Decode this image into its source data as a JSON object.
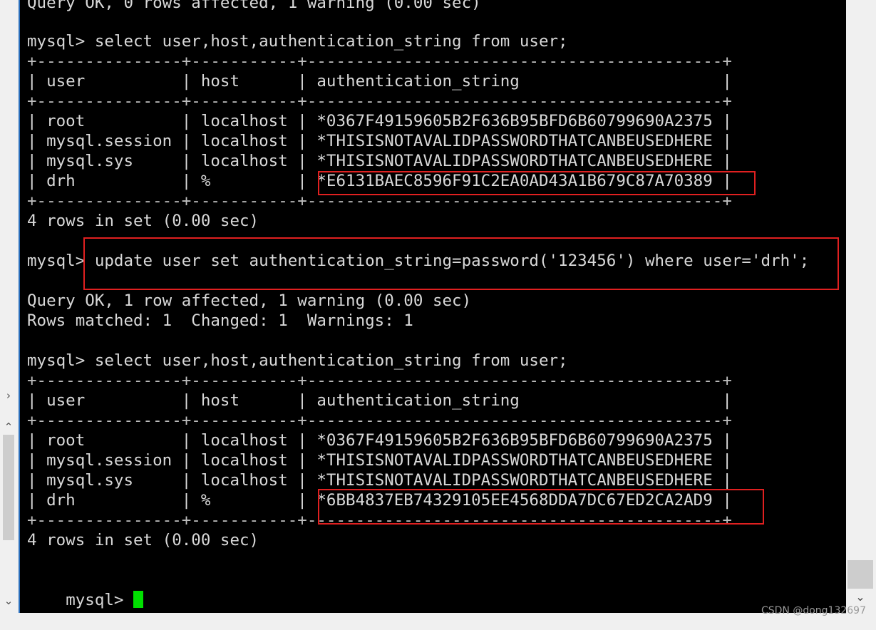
{
  "terminal": {
    "lines": [
      "Query OK, 0 rows affected, 1 warning (0.00 sec)",
      "",
      "mysql> select user,host,authentication_string from user;",
      "+---------------+-----------+-------------------------------------------+",
      "| user          | host      | authentication_string                     |",
      "+---------------+-----------+-------------------------------------------+",
      "| root          | localhost | *0367F49159605B2F636B95BFD6B60799690A2375 |",
      "| mysql.session | localhost | *THISISNOTAVALIDPASSWORDTHATCANBEUSEDHERE |",
      "| mysql.sys     | localhost | *THISISNOTAVALIDPASSWORDTHATCANBEUSEDHERE |",
      "| drh           | %         | *E6131BAEC8596F91C2EA0AD43A1B679C87A70389 |",
      "+---------------+-----------+-------------------------------------------+",
      "4 rows in set (0.00 sec)",
      "",
      "mysql> update user set authentication_string=password('123456') where user='drh';",
      "",
      "Query OK, 1 row affected, 1 warning (0.00 sec)",
      "Rows matched: 1  Changed: 1  Warnings: 1",
      "",
      "mysql> select user,host,authentication_string from user;",
      "+---------------+-----------+-------------------------------------------+",
      "| user          | host      | authentication_string                     |",
      "+---------------+-----------+-------------------------------------------+",
      "| root          | localhost | *0367F49159605B2F636B95BFD6B60799690A2375 |",
      "| mysql.session | localhost | *THISISNOTAVALIDPASSWORDTHATCANBEUSEDHERE |",
      "| mysql.sys     | localhost | *THISISNOTAVALIDPASSWORDTHATCANBEUSEDHERE |",
      "| drh           | %         | *6BB4837EB74329105EE4568DDA7DC67ED2CA2AD9 |",
      "+---------------+-----------+-------------------------------------------+",
      "4 rows in set (0.00 sec)",
      "",
      "mysql> "
    ],
    "highlight_color": "#e02020",
    "cursor_color": "#00e000"
  },
  "left_strip": {
    "expand_glyph": "›",
    "up_glyph": "⌃",
    "down_glyph": "⌄"
  },
  "scrollbar": {
    "down_glyph": "⌄"
  },
  "watermark": "CSDN @dong132697"
}
